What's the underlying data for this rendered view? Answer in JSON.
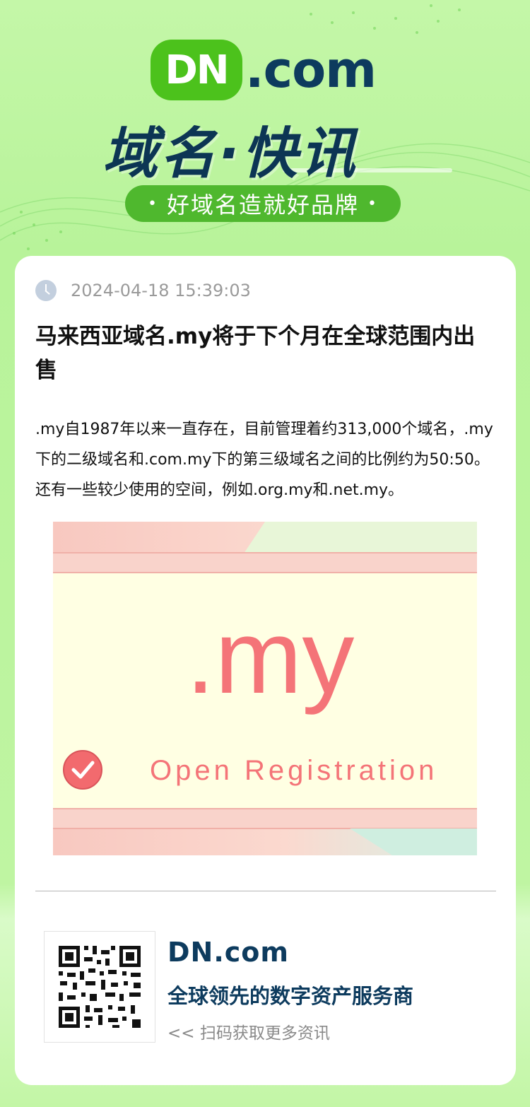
{
  "header": {
    "logo_badge": "DN",
    "logo_suffix": ".com",
    "headline": "域名·快讯",
    "slogan": "好域名造就好品牌",
    "slogan_dot": "•"
  },
  "article": {
    "timestamp": "2024-04-18 15:39:03",
    "title": "马来西亚域名.my将于下个月在全球范围内出售",
    "body": ".my自1987年以来一直存在，目前管理着约313,000个域名，.my下的二级域名和.com.my下的第三级域名之间的比例约为50:50。还有一些较少使用的空间，例如.org.my和.net.my。",
    "image": {
      "domain_text": ".my",
      "caption": "Open Registration",
      "check_icon": "check-circle-icon"
    }
  },
  "footer": {
    "brand": "DN.com",
    "tagline": "全球领先的数字资产服务商",
    "scan_prompt": "<< 扫码获取更多资讯"
  },
  "colors": {
    "brand_green": "#4cc21c",
    "brand_navy": "#0d3b5e",
    "image_coral": "#f47478",
    "background_green": "#c4f7a8"
  }
}
